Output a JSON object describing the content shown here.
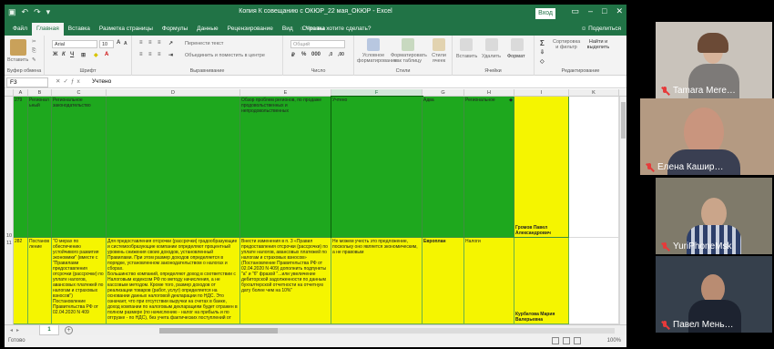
{
  "excel": {
    "title": "Копия К совещанию с ОКЮР_22 мая_ОКЮР  -  Excel",
    "login_label": "Вход",
    "tabs": [
      "Файл",
      "Главная",
      "Вставка",
      "Разметка страницы",
      "Формулы",
      "Данные",
      "Рецензирование",
      "Вид",
      "Справка"
    ],
    "active_tab": "Главная",
    "tell_me": "Что вы хотите сделать?",
    "share": "Поделиться",
    "ribbon": {
      "paste": "Вставить",
      "clipboard": "Буфер обмена",
      "font_name": "Arial",
      "font_size": "10",
      "font_group": "Шрифт",
      "wrap_text": "Перенести текст",
      "merge_center": "Объединить и поместить в центре",
      "alignment_group": "Выравнивание",
      "number_format": "Общий",
      "number_group": "Число",
      "cond_format": "Условное форматирование",
      "format_table": "Форматировать как таблицу",
      "cell_styles": "Стили ячеек",
      "styles_group": "Стили",
      "insert": "Вставить",
      "delete": "Удалить",
      "format": "Формат",
      "cells_group": "Ячейки",
      "sort_filter": "Сортировка и фильтр",
      "find_select": "Найти и выделить",
      "editing_group": "Редактирование"
    },
    "name_box": "F3",
    "formula": "Учтено",
    "columns": [
      "A",
      "B",
      "C",
      "D",
      "E",
      "F",
      "G",
      "H",
      "I",
      "K"
    ],
    "selected_column": "F",
    "row_numbers": [
      "10",
      "11"
    ],
    "header_row": {
      "a": "279",
      "b": "Регионал ьный",
      "c": "Региональное законодательство",
      "e": "Обзор проблем регионов, по продаже продовольственных и непродовольственных",
      "f": "Учтено",
      "g": "Адва",
      "h": "Региональное",
      "i": "Громов Павел Александрович"
    },
    "data_row": {
      "a": "282",
      "b": "Постанов ление",
      "c": "\"О мерах по обеспечению устойчивого развития экономики\" (вместе с \"Правилами предоставления отсрочки (рассрочки) по уплате налогов, авансовых платежей по налогам и страховых взносов\") Постановление Правительства РФ от 02.04.2020 N 409",
      "d": "Для предоставления отсрочки (рассрочки) градообразующие и системообразующие компании определяют процентный уровень снижения своих доходов, установленный Правилами. При этом размер доходов определяется в порядке, установленном законодательством о налогах и сборах.\nБольшинство компаний, определяют доход в соответствии с Налоговым кодексом РФ по методу начисления, а не кассовым методом. Кроме того, размер доходов от реализации товаров (работ, услуг) определяется на основании данных налоговой декларации по НДС. Это означает, что при отсутствии выручки на счетах в банке, доход компании по налоговым декларациям будет отражен в полном размере (по начислению - налог на прибыль и по отгрузке - по НДС), без учета фактических поступлений от",
      "e": "Внести изменения в п. 3 «Правил предоставления отсрочки (рассрочки) по уплате налогов, авансовых платежей по налогам и страховых взносов» (Постановление Правительства РФ от 02.04.2020 N 409) дополнить подпункты \"а\" и \"б\" фразой \"...или увеличение дебиторской задолженности по данным бухгалтерской отчетности на отчетную дату более чем на 10%\"",
      "f": "Не можем учесть это предложение, поскольку оно является экономическим, а не правовым",
      "g": "Европлан",
      "h": "Налоги",
      "i": "Курбатова Мария Валерьевна"
    },
    "sheet_tab": "1",
    "status": "Готово",
    "zoom": "100%"
  },
  "participants": [
    {
      "name": "Tamara Mere…",
      "muted": true
    },
    {
      "name": "Елена Кашир…",
      "muted": true
    },
    {
      "name": "YuriPhoneMsk",
      "muted": true
    },
    {
      "name": "Павел Мень…",
      "muted": true
    }
  ]
}
